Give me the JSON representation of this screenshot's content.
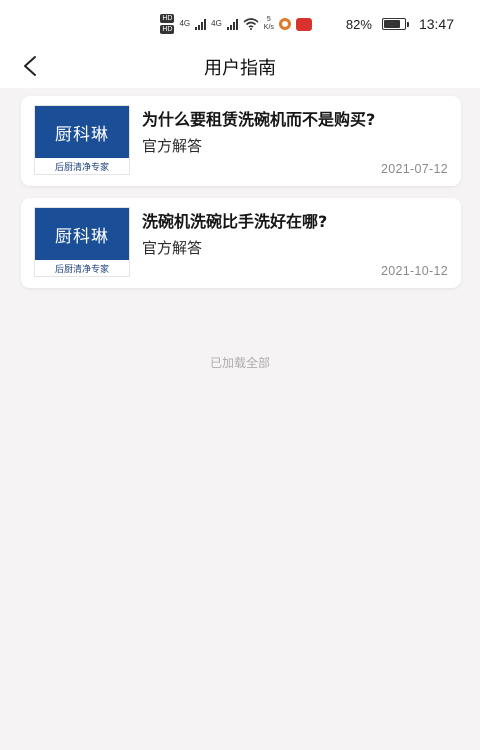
{
  "status_bar": {
    "hd_labels": [
      "HD",
      "HD"
    ],
    "net_1": "4G",
    "net_2": "4G",
    "speed_value": "5",
    "speed_unit": "K/s",
    "battery_percent": "82%",
    "battery_level": 0.82,
    "time": "13:47",
    "app_badge_color": "#d8322e",
    "app_ring_color": "#e07a2a"
  },
  "nav": {
    "back_icon": "chevron-left-icon",
    "title": "用户指南"
  },
  "articles": [
    {
      "thumb_logo": "厨科琳",
      "thumb_slogan": "后厨清净专家",
      "title": "为什么要租赁洗碗机而不是购买?",
      "tag": "官方解答",
      "date": "2021-07-12"
    },
    {
      "thumb_logo": "厨科琳",
      "thumb_slogan": "后厨清净专家",
      "title": "洗碗机洗碗比手洗好在哪?",
      "tag": "官方解答",
      "date": "2021-10-12"
    }
  ],
  "footer": {
    "loaded_all": "已加载全部"
  },
  "colors": {
    "page_background": "#f6f3f5",
    "card_background": "#ffffff",
    "logo_blue": "#1a4f97"
  }
}
